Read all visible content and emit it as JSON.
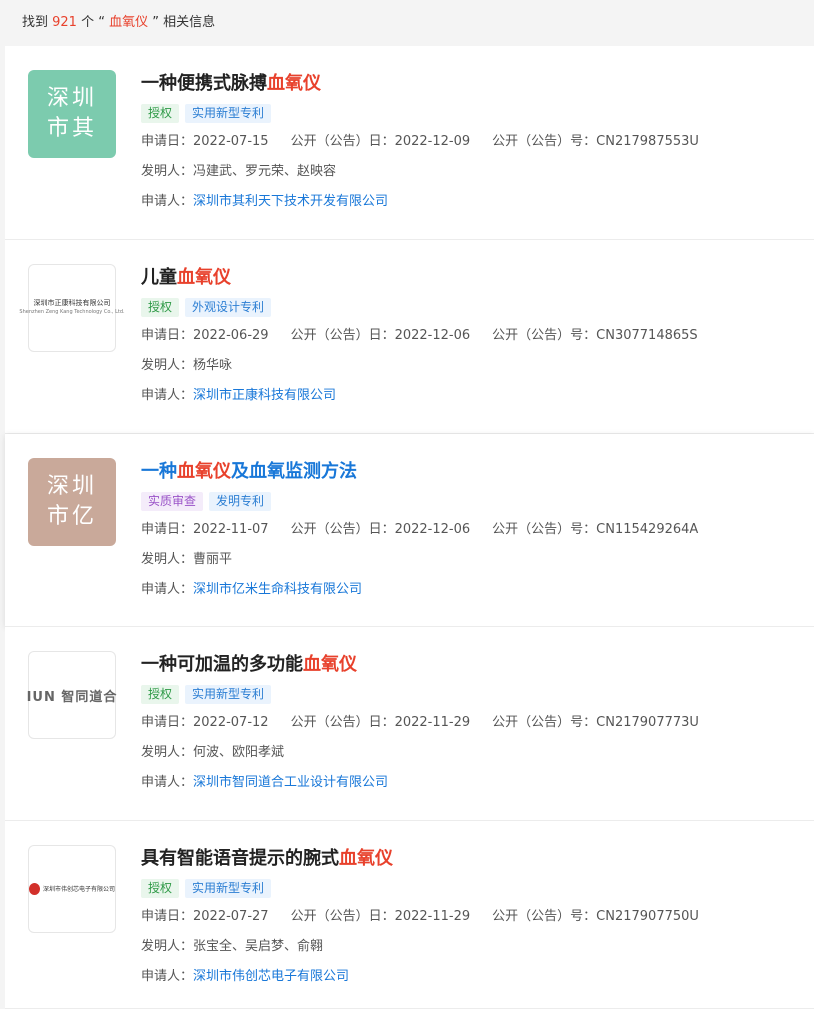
{
  "summary": {
    "prefix": "找到 ",
    "count": "921",
    "middle": " 个 “ ",
    "keyword": "血氧仪",
    "suffix": " ” 相关信息"
  },
  "labels": {
    "apply_date": "申请日：",
    "pub_date": "公开（公告）日：",
    "pub_no": "公开（公告）号：",
    "inventor": "发明人：",
    "applicant": "申请人："
  },
  "colors": {
    "accent_red": "#e8412c",
    "link_blue": "#1877d8",
    "logo_green": "#7ccbae",
    "logo_brown": "#c9a99a"
  },
  "results": [
    {
      "title_pre": "一种便携式脉搏",
      "title_hl": "血氧仪",
      "title_post": "",
      "tag1": "授权",
      "tag2": "实用新型专利",
      "apply_date": "2022-07-15",
      "pub_date": "2022-12-09",
      "pub_no": "CN217987553U",
      "inventors": "冯建武、罗元荣、赵映容",
      "applicant": "深圳市其利天下技术开发有限公司",
      "logo_line1": "深圳",
      "logo_line2": "市其"
    },
    {
      "title_pre": "儿童",
      "title_hl": "血氧仪",
      "title_post": "",
      "tag1": "授权",
      "tag2": "外观设计专利",
      "apply_date": "2022-06-29",
      "pub_date": "2022-12-06",
      "pub_no": "CN307714865S",
      "inventors": "杨华咏",
      "applicant": "深圳市正康科技有限公司",
      "logo_line1": "深圳市正康科技有限公司",
      "logo_line2": "Shenzhen Zeng Kang Technology Co., Ltd."
    },
    {
      "title_pre": "一种",
      "title_hl": "血氧仪",
      "title_post": "及血氧监测方法",
      "tag1": "实质审查",
      "tag2": "发明专利",
      "apply_date": "2022-11-07",
      "pub_date": "2022-12-06",
      "pub_no": "CN115429264A",
      "inventors": "曹丽平",
      "applicant": "深圳市亿米生命科技有限公司",
      "logo_line1": "深圳",
      "logo_line2": "市亿"
    },
    {
      "title_pre": "一种可加温的多功能",
      "title_hl": "血氧仪",
      "title_post": "",
      "tag1": "授权",
      "tag2": "实用新型专利",
      "apply_date": "2022-07-12",
      "pub_date": "2022-11-29",
      "pub_no": "CN217907773U",
      "inventors": "何波、欧阳孝斌",
      "applicant": "深圳市智同道合工业设计有限公司",
      "logo_line1": "IUN 智同道合",
      "logo_line2": ""
    },
    {
      "title_pre": "具有智能语音提示的腕式",
      "title_hl": "血氧仪",
      "title_post": "",
      "tag1": "授权",
      "tag2": "实用新型专利",
      "apply_date": "2022-07-27",
      "pub_date": "2022-11-29",
      "pub_no": "CN217907750U",
      "inventors": "张宝全、吴启梦、俞翱",
      "applicant": "深圳市伟创芯电子有限公司",
      "logo_line1": "深圳市伟创芯电子有限公司",
      "logo_line2": ""
    }
  ]
}
